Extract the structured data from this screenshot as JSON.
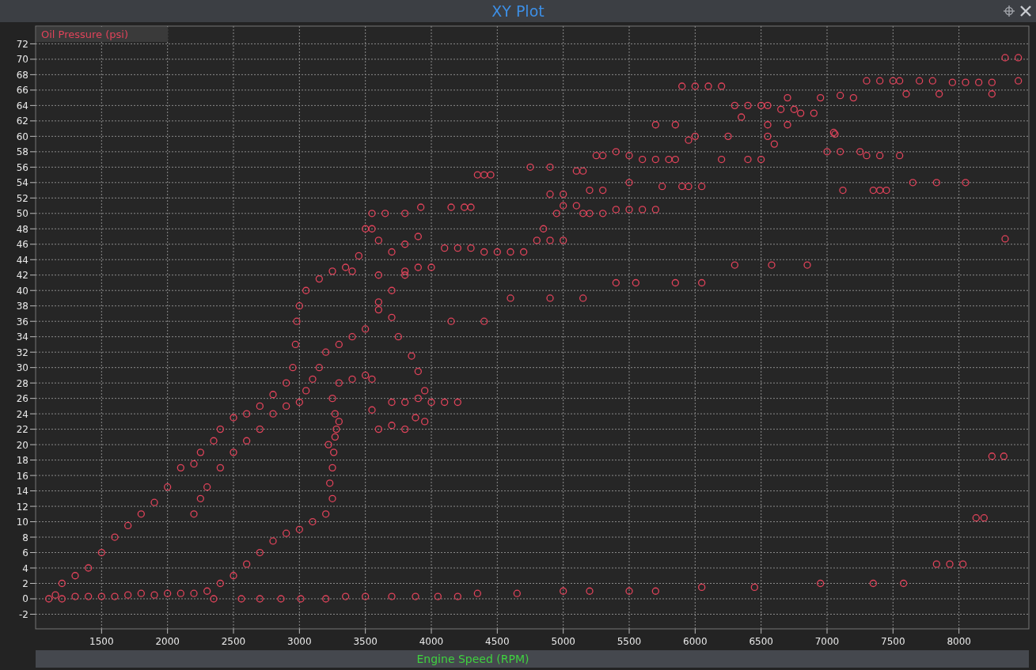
{
  "window": {
    "title": "XY Plot"
  },
  "chart_data": {
    "type": "scatter",
    "grid": true,
    "xlabel": "Engine Speed (RPM)",
    "xlim": [
      1000,
      8530
    ],
    "ylim": [
      -3.9,
      74.3
    ],
    "xticks": [
      1500,
      2000,
      2500,
      3000,
      3500,
      4000,
      4500,
      5000,
      5500,
      6000,
      6500,
      7000,
      7500,
      8000
    ],
    "yticks": [
      -2,
      0,
      2,
      4,
      6,
      8,
      10,
      12,
      14,
      16,
      18,
      20,
      22,
      24,
      26,
      28,
      30,
      32,
      34,
      36,
      38,
      40,
      42,
      44,
      46,
      48,
      50,
      52,
      54,
      56,
      58,
      60,
      62,
      64,
      66,
      68,
      70,
      72
    ],
    "x": [
      1100,
      1150,
      1200,
      1300,
      1400,
      1500,
      1600,
      1700,
      1800,
      1900,
      2000,
      2100,
      2200,
      2300,
      2350,
      2560,
      2700,
      2860,
      3010,
      3200,
      3350,
      3500,
      3700,
      3880,
      4050,
      4200,
      4350,
      4650,
      5000,
      5200,
      5500,
      5700,
      6050,
      6450,
      6950,
      7350,
      7580,
      2400,
      2500,
      2600,
      2700,
      2800,
      2900,
      3000,
      3100,
      3200,
      3250,
      3230,
      3250,
      3260,
      3270,
      3280,
      3270,
      3250,
      3300,
      3220,
      3300,
      3400,
      3500,
      3550,
      1200,
      1300,
      1400,
      1500,
      1600,
      1700,
      1800,
      1900,
      2000,
      2100,
      2200,
      2250,
      2350,
      2400,
      2500,
      2600,
      2700,
      2800,
      2900,
      2950,
      2970,
      2980,
      3000,
      3050,
      3150,
      3250,
      3350,
      3450,
      3500,
      3550,
      3600,
      3700,
      3800,
      3900,
      2200,
      2250,
      2300,
      2400,
      2500,
      2600,
      2700,
      2800,
      2900,
      3000,
      3050,
      3100,
      3150,
      3200,
      3300,
      3400,
      3500,
      3600,
      3700,
      3800,
      3900,
      3400,
      3600,
      3800,
      4000,
      4100,
      4200,
      4300,
      4400,
      4500,
      4600,
      4700,
      3600,
      3700,
      3750,
      3850,
      3900,
      3950,
      4000,
      4100,
      4200,
      3600,
      3700,
      3800,
      3880,
      3950,
      3700,
      3800,
      3550,
      3900,
      4150,
      4400,
      3920,
      4150,
      4250,
      4300,
      3550,
      3650,
      3800,
      4350,
      4400,
      4450,
      4750,
      4900,
      4600,
      4900,
      5150,
      4800,
      4900,
      5000,
      4850,
      4950,
      4900,
      5000,
      5000,
      5100,
      5150,
      5200,
      5300,
      5400,
      5500,
      5600,
      5700,
      5100,
      5150,
      5200,
      5250,
      5300,
      5400,
      5500,
      5500,
      5600,
      5700,
      5800,
      5850,
      5300,
      5750,
      5900,
      5950,
      6050,
      5700,
      5850,
      5950,
      6000,
      5900,
      6000,
      6100,
      6200,
      6200,
      6250,
      6300,
      6400,
      6500,
      6350,
      6400,
      6500,
      6550,
      6550,
      6600,
      6650,
      6700,
      6700,
      6750,
      6800,
      6900,
      6950,
      7000,
      7050,
      7100,
      7100,
      7200,
      7250,
      7300,
      7300,
      7400,
      7400,
      7500,
      7550,
      7550,
      7600,
      7700,
      7800,
      7850,
      7950,
      8050,
      8150,
      8250,
      8250,
      8350,
      8450,
      8450,
      7120,
      7350,
      7400,
      7450,
      7650,
      7830,
      8050,
      6300,
      6580,
      6850,
      5400,
      5550,
      5850,
      6050,
      8350,
      8250,
      8340,
      8130,
      8190,
      7830,
      7930,
      8030,
      7060,
      6550
    ],
    "series": [
      {
        "name": "Oil Pressure (psi)",
        "color": "#e0435a",
        "values": [
          0,
          0.5,
          0,
          0.3,
          0.3,
          0.3,
          0.3,
          0.5,
          0.7,
          0.5,
          0.7,
          0.7,
          0.7,
          1,
          0,
          0,
          0,
          0,
          0,
          0,
          0.3,
          0.3,
          0.3,
          0.3,
          0.3,
          0.3,
          0.7,
          0.7,
          1,
          1,
          1,
          1,
          1.5,
          1.5,
          2,
          2,
          2,
          2,
          3,
          4.5,
          6,
          7.5,
          8.5,
          9,
          10,
          11,
          13,
          15,
          17,
          19,
          21,
          22,
          24,
          26,
          23,
          20,
          28,
          28.5,
          29,
          28.5,
          2,
          3,
          4,
          6,
          8,
          9.5,
          11,
          12.5,
          14.5,
          17,
          17.5,
          19,
          20.5,
          22,
          23.5,
          24,
          25,
          26.5,
          28,
          30,
          33,
          36,
          38,
          40,
          41.5,
          42.5,
          43,
          44.5,
          48,
          48,
          46.5,
          45,
          46,
          47,
          11,
          13,
          14.5,
          17,
          19,
          20.5,
          22,
          24,
          25,
          25.5,
          27,
          28.5,
          30,
          32,
          33,
          34,
          35,
          37.5,
          40,
          42,
          43,
          42.5,
          42,
          42.5,
          43,
          45.5,
          45.5,
          45.5,
          45,
          45,
          45,
          45,
          38.5,
          36.5,
          34,
          31.5,
          29.5,
          27,
          25.5,
          25.5,
          25.5,
          22,
          22.5,
          22,
          23.5,
          23,
          25.5,
          25.5,
          24.5,
          26,
          36,
          36,
          50.8,
          50.8,
          50.8,
          50.8,
          50,
          50,
          50,
          55,
          55,
          55,
          56,
          56,
          39,
          39,
          39,
          46.5,
          46.5,
          46.5,
          48,
          50,
          52.5,
          52.5,
          51,
          51,
          50,
          50,
          50,
          50.5,
          50.5,
          50.5,
          50.5,
          55.5,
          55.5,
          53,
          57.5,
          57.5,
          58,
          54,
          57.5,
          57,
          57,
          57,
          57,
          53,
          53.5,
          53.5,
          53.5,
          53.5,
          61.5,
          61.5,
          59.5,
          60,
          66.5,
          66.5,
          66.5,
          66.5,
          57,
          60,
          64,
          64,
          64,
          62.5,
          57,
          57,
          60,
          61.5,
          59,
          63.5,
          61.5,
          65,
          63.5,
          63,
          63,
          65,
          58,
          60.5,
          58,
          65.3,
          65,
          58,
          67.2,
          57.5,
          67.2,
          57.5,
          67.2,
          67.2,
          57.5,
          65.5,
          67.2,
          67.2,
          65.5,
          67,
          67,
          67,
          67,
          65.5,
          70.2,
          70.2,
          67.2,
          53,
          53,
          53,
          53,
          54,
          54,
          54,
          43.3,
          43.3,
          43.3,
          41,
          41,
          41,
          41,
          46.7,
          18.5,
          18.5,
          10.5,
          10.5,
          4.5,
          4.5,
          4.5,
          60.3,
          64
        ]
      }
    ]
  }
}
